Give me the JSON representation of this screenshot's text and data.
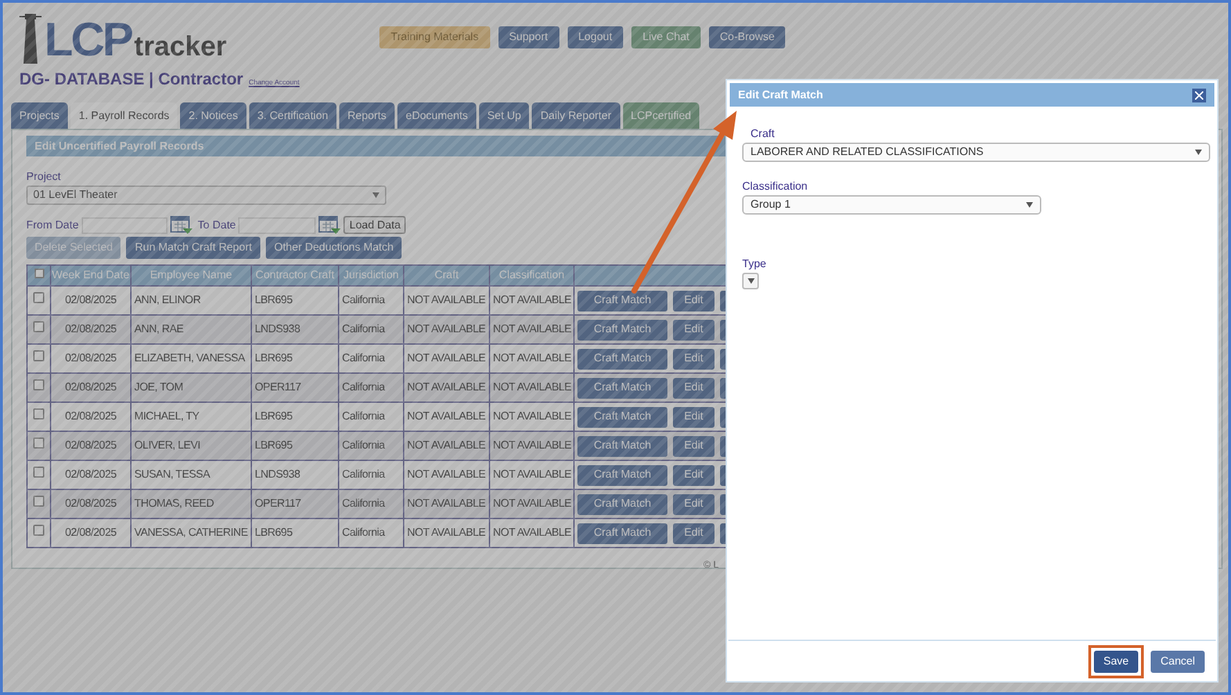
{
  "header": {
    "logo": {
      "mark": "LCP",
      "word": "tracker"
    },
    "account": "DG- DATABASE | Contractor",
    "change_account": "Change Account",
    "buttons": [
      {
        "label": "Training Materials",
        "kind": "training"
      },
      {
        "label": "Support",
        "kind": "normal"
      },
      {
        "label": "Logout",
        "kind": "normal"
      },
      {
        "label": "Live Chat",
        "kind": "chat"
      },
      {
        "label": "Co-Browse",
        "kind": "normal"
      }
    ]
  },
  "tabs": [
    {
      "label": "Projects",
      "selected": false,
      "kind": "normal"
    },
    {
      "label": "1. Payroll Records",
      "selected": true,
      "kind": "normal"
    },
    {
      "label": "2. Notices",
      "selected": false,
      "kind": "normal"
    },
    {
      "label": "3. Certification",
      "selected": false,
      "kind": "normal"
    },
    {
      "label": "Reports",
      "selected": false,
      "kind": "normal"
    },
    {
      "label": "eDocuments",
      "selected": false,
      "kind": "normal"
    },
    {
      "label": "Set Up",
      "selected": false,
      "kind": "normal"
    },
    {
      "label": "Daily Reporter",
      "selected": false,
      "kind": "normal"
    },
    {
      "label": "LCPcertified",
      "selected": false,
      "kind": "green"
    }
  ],
  "panel": {
    "title": "Edit Uncertified Payroll Records",
    "project_label": "Project",
    "project_value": "01 LevEl Theater",
    "from_date_label": "From Date",
    "to_date_label": "To Date",
    "load_button": "Load Data",
    "actions": [
      {
        "label": "Delete Selected",
        "disabled": true
      },
      {
        "label": "Run Match Craft Report",
        "disabled": false
      },
      {
        "label": "Other Deductions Match",
        "disabled": false
      }
    ]
  },
  "table": {
    "select_all_checked": false,
    "columns": [
      "Week End Date",
      "Employee Name",
      "Contractor Craft",
      "Jurisdiction",
      "Craft",
      "Classification"
    ],
    "rows": [
      {
        "checked": false,
        "cells": [
          "02/08/2025",
          "ANN, ELINOR",
          "LBR695",
          "California",
          "NOT AVAILABLE",
          "NOT AVAILABLE"
        ],
        "match_button": "Craft Match",
        "edit_button": "Edit"
      },
      {
        "checked": false,
        "cells": [
          "02/08/2025",
          "ANN, RAE",
          "LNDS938",
          "California",
          "NOT AVAILABLE",
          "NOT AVAILABLE"
        ],
        "match_button": "Craft Match",
        "edit_button": "Edit"
      },
      {
        "checked": false,
        "cells": [
          "02/08/2025",
          "ELIZABETH, VANESSA",
          "LBR695",
          "California",
          "NOT AVAILABLE",
          "NOT AVAILABLE"
        ],
        "match_button": "Craft Match",
        "edit_button": "Edit"
      },
      {
        "checked": false,
        "cells": [
          "02/08/2025",
          "JOE, TOM",
          "OPER117",
          "California",
          "NOT AVAILABLE",
          "NOT AVAILABLE"
        ],
        "match_button": "Craft Match",
        "edit_button": "Edit"
      },
      {
        "checked": false,
        "cells": [
          "02/08/2025",
          "MICHAEL, TY",
          "LBR695",
          "California",
          "NOT AVAILABLE",
          "NOT AVAILABLE"
        ],
        "match_button": "Craft Match",
        "edit_button": "Edit"
      },
      {
        "checked": false,
        "cells": [
          "02/08/2025",
          "OLIVER, LEVI",
          "LBR695",
          "California",
          "NOT AVAILABLE",
          "NOT AVAILABLE"
        ],
        "match_button": "Craft Match",
        "edit_button": "Edit"
      },
      {
        "checked": false,
        "cells": [
          "02/08/2025",
          "SUSAN, TESSA",
          "LNDS938",
          "California",
          "NOT AVAILABLE",
          "NOT AVAILABLE"
        ],
        "match_button": "Craft Match",
        "edit_button": "Edit"
      },
      {
        "checked": false,
        "cells": [
          "02/08/2025",
          "THOMAS, REED",
          "OPER117",
          "California",
          "NOT AVAILABLE",
          "NOT AVAILABLE"
        ],
        "match_button": "Craft Match",
        "edit_button": "Edit"
      },
      {
        "checked": false,
        "cells": [
          "02/08/2025",
          "VANESSA, CATHERINE",
          "LBR695",
          "California",
          "NOT AVAILABLE",
          "NOT AVAILABLE"
        ],
        "match_button": "Craft Match",
        "edit_button": "Edit"
      }
    ]
  },
  "footer": "© L",
  "dialog": {
    "title": "Edit Craft Match",
    "craft_label": "Craft",
    "craft_value": "LABORER AND RELATED CLASSIFICATIONS",
    "classification_label": "Classification",
    "classification_value": "Group 1",
    "type_label": "Type",
    "buttons": [
      {
        "label": "Save",
        "highlighted": true
      },
      {
        "label": "Cancel",
        "highlighted": false
      }
    ]
  }
}
